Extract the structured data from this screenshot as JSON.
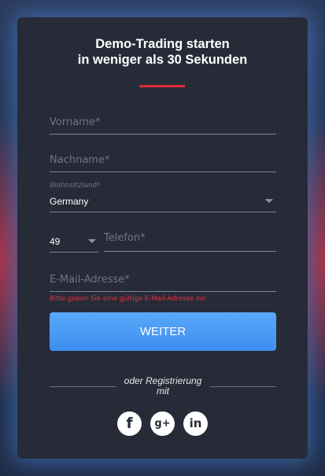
{
  "form": {
    "title_line1": "Demo-Trading starten",
    "title_line2": "in weniger als 30 Sekunden",
    "first_name_placeholder": "Vorname*",
    "last_name_placeholder": "Nachname*",
    "country_label": "Wohnsitzland*",
    "country_value": "Germany",
    "phone_code_value": "49",
    "phone_placeholder": "Telefon*",
    "email_placeholder": "E-Mail-Adresse*",
    "email_error": "Bitte geben Sie eine gültige E-Mail-Adresse ein",
    "submit_label": "WEITER"
  },
  "social": {
    "separator_text": "oder Registrierung mit",
    "facebook_glyph": "f",
    "googleplus_glyph": "g+",
    "linkedin_glyph": "in",
    "icons": [
      "facebook-icon",
      "google-plus-icon",
      "linkedin-icon"
    ]
  },
  "colors": {
    "card_background": "#262b37",
    "accent_red": "#e02a36",
    "button_blue": "#4a9bf6",
    "error_red": "#e0333f"
  }
}
